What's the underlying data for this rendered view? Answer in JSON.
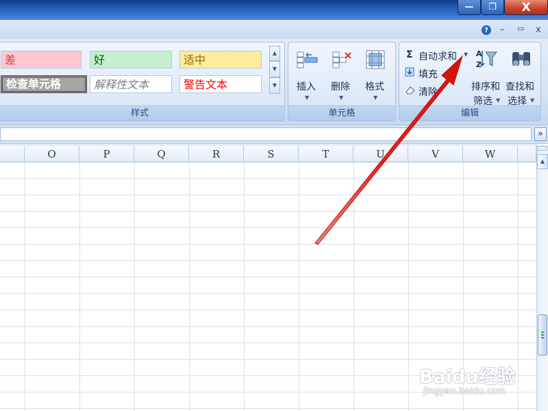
{
  "window": {
    "minimize_label": "—",
    "maximize_label": "❐",
    "close_label": "X"
  },
  "menustrip": {
    "help_label": "?",
    "min_label": "–",
    "restore_label": "▭",
    "close_label": "x"
  },
  "ribbon": {
    "styles": {
      "group_label": "样式",
      "cells": {
        "bad": "差",
        "good": "好",
        "neutral": "适中",
        "check_cell": "检查单元格",
        "explanatory": "解释性文本",
        "warning": "警告文本"
      },
      "colors": {
        "bad_bg": "#ffc7ce",
        "bad_fg": "#9c0006",
        "good_bg": "#c6efce",
        "good_fg": "#006100",
        "neutral_bg": "#ffeb9c",
        "neutral_fg": "#9c6500",
        "check_bg": "#a5a5a5",
        "warning_fg": "#ff0000",
        "explanatory_fg": "#7f7f7f"
      }
    },
    "cells_group": {
      "group_label": "单元格",
      "insert_label": "插入",
      "delete_label": "删除",
      "format_label": "格式"
    },
    "editing": {
      "group_label": "编辑",
      "autosum_label": "自动求和",
      "fill_label": "填充",
      "clear_label": "清除",
      "sort_label_1": "排序和",
      "sort_label_2": "筛选",
      "find_label_1": "查找和",
      "find_label_2": "选择"
    }
  },
  "formula_bar": {
    "expand_label": "»"
  },
  "sheet": {
    "columns": [
      "",
      "O",
      "P",
      "Q",
      "R",
      "S",
      "T",
      "U",
      "V",
      "W"
    ]
  },
  "annotation": {
    "arrow_color": "#e8221d"
  },
  "watermark": {
    "brand": "Baidu经验",
    "url": "jingyan.baidu.com"
  }
}
